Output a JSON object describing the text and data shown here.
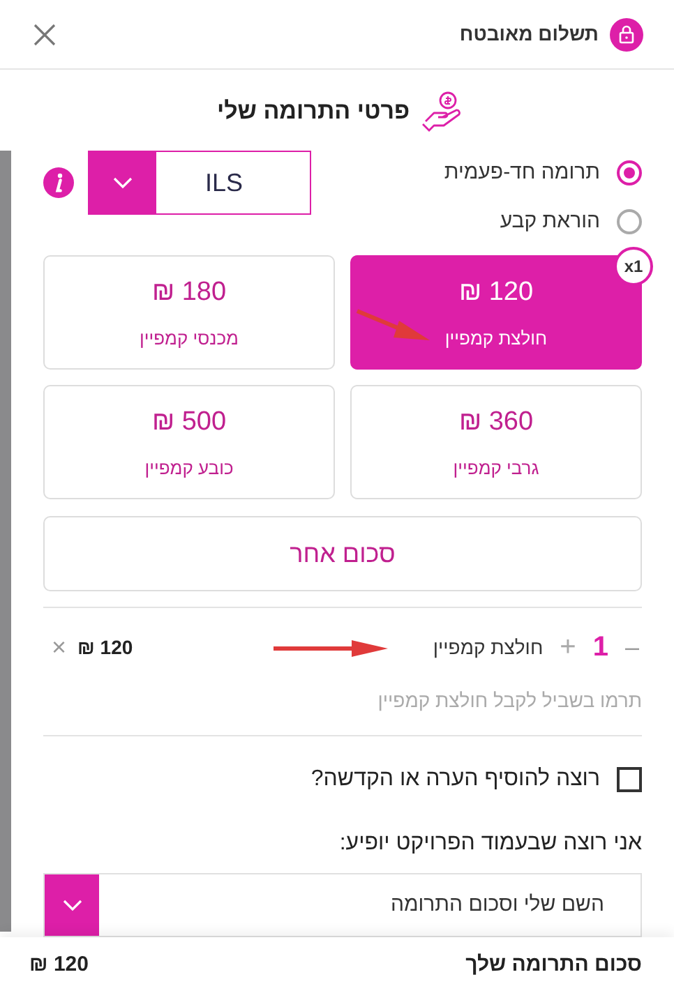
{
  "header": {
    "title": "תשלום מאובטח"
  },
  "section_title": "פרטי התרומה שלי",
  "frequency": [
    {
      "label": "תרומה חד-פעמית",
      "selected": true
    },
    {
      "label": "הוראת קבע",
      "selected": false
    }
  ],
  "currency": {
    "value": "ILS"
  },
  "amounts": [
    {
      "amount": "120 ₪",
      "name": "חולצת קמפיין",
      "selected": true,
      "badge": "x1"
    },
    {
      "amount": "180 ₪",
      "name": "מכנסי קמפיין",
      "selected": false
    },
    {
      "amount": "360 ₪",
      "name": "גרבי קמפיין",
      "selected": false
    },
    {
      "amount": "500 ₪",
      "name": "כובע קמפיין",
      "selected": false
    }
  ],
  "other_amount": "סכום אחר",
  "cart": {
    "decrement": "–",
    "quantity": "1",
    "increment": "+",
    "item": "חולצת קמפיין",
    "price": "120 ₪",
    "remove": "×"
  },
  "cart_note": "תרמו בשביל לקבל חולצת קמפיין",
  "dedication": {
    "label": "רוצה להוסיף הערה או הקדשה?",
    "checked": false
  },
  "display": {
    "label": "אני רוצה שבעמוד הפרויקט יופיע:",
    "value": "השם שלי וסכום התרומה"
  },
  "footer": {
    "label": "סכום התרומה שלך",
    "total": "120 ₪"
  }
}
